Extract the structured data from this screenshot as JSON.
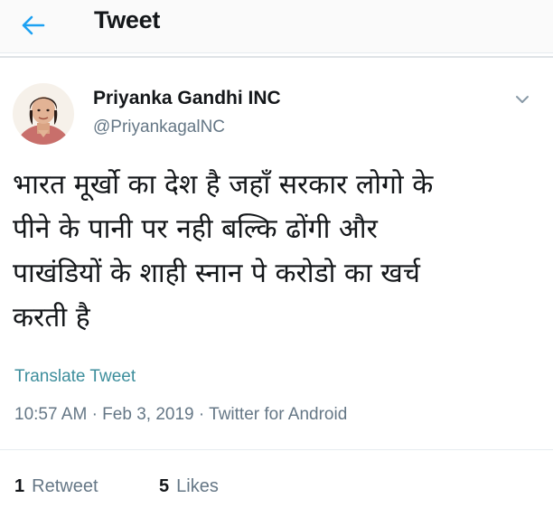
{
  "header": {
    "title": "Tweet",
    "back_icon": "back-arrow-icon"
  },
  "tweet": {
    "display_name": "Priyanka Gandhi INC",
    "handle": "@PriyankagalNC",
    "text": "भारत मूर्खो का देश है जहाँ सरकार लोगो के\nपीने के पानी पर नही बल्कि ढोंगी और\nपाखंडियों के शाही स्नान पे करोडो का खर्च\nकरती है",
    "translate_label": "Translate Tweet",
    "time": "10:57 AM",
    "date": "Feb 3, 2019",
    "source": "Twitter for Android",
    "separator": "·"
  },
  "stats": {
    "retweets_count": "1",
    "retweets_label": "Retweet",
    "likes_count": "5",
    "likes_label": "Likes"
  },
  "colors": {
    "accent": "#3d8e9c",
    "muted": "#657786",
    "text": "#14171a"
  }
}
